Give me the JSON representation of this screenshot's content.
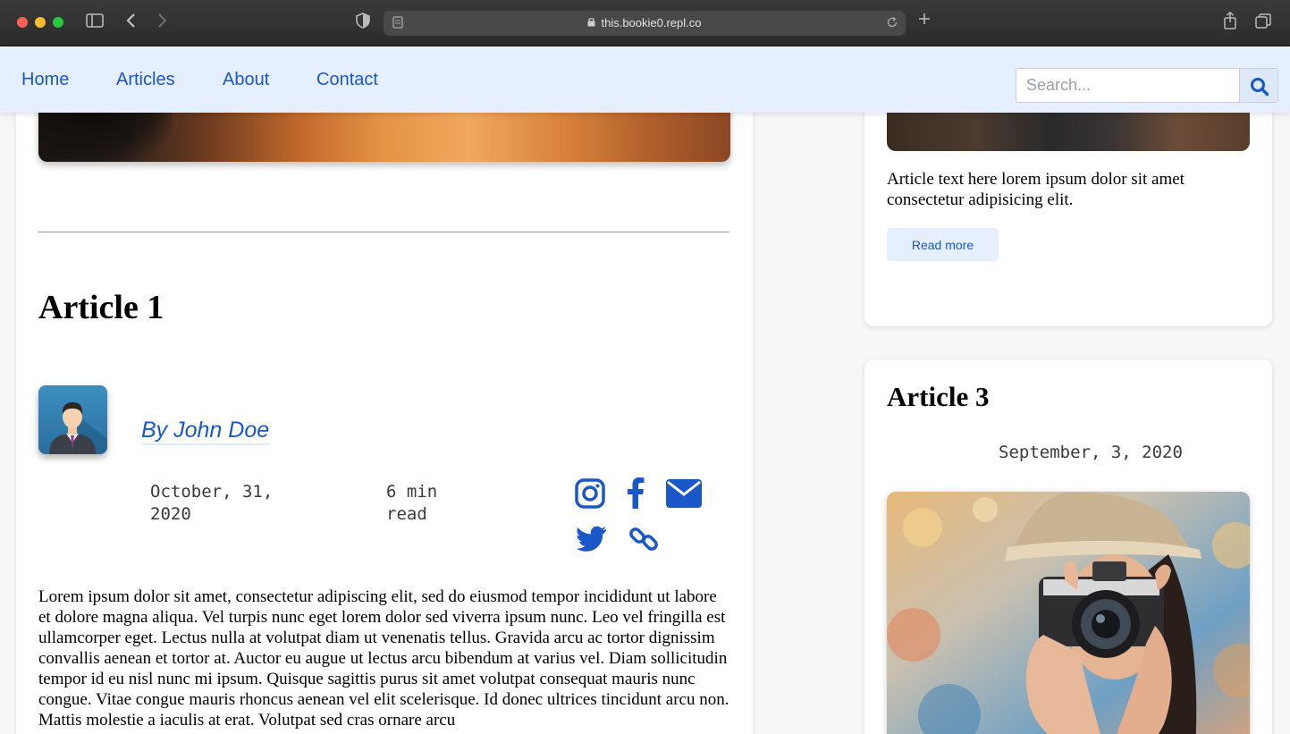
{
  "browser": {
    "url": "this.bookie0.repl.co"
  },
  "nav": {
    "links": [
      "Home",
      "Articles",
      "About",
      "Contact"
    ],
    "search_placeholder": "Search..."
  },
  "article1": {
    "title": "Article 1",
    "author": "By John Doe",
    "date": "October, 31, 2020",
    "read_time": "6 min read",
    "body": "Lorem ipsum dolor sit amet, consectetur adipiscing elit, sed do eiusmod tempor incididunt ut labore et dolore magna aliqua. Vel turpis nunc eget lorem dolor sed viverra ipsum nunc. Leo vel fringilla est ullamcorper eget. Lectus nulla at volutpat diam ut venenatis tellus. Gravida arcu ac tortor dignissim convallis aenean et tortor at. Auctor eu augue ut lectus arcu bibendum at varius vel. Diam sollicitudin tempor id eu nisl nunc mi ipsum. Quisque sagittis purus sit amet volutpat consequat mauris nunc congue. Vitae congue mauris rhoncus aenean vel elit scelerisque. Id donec ultrices tincidunt arcu non. Mattis molestie a iaculis at erat. Volutpat sed cras ornare arcu",
    "social_icons": [
      "instagram-icon",
      "facebook-icon",
      "email-icon",
      "twitter-icon",
      "link-icon"
    ]
  },
  "card2": {
    "text": "Article text here lorem ipsum dolor sit amet consectetur adipisicing elit.",
    "button": "Read more"
  },
  "card3": {
    "title": "Article 3",
    "date": "September, 3, 2020"
  },
  "colors": {
    "accent": "#1a57c9",
    "navbar_bg": "#e5efff"
  }
}
